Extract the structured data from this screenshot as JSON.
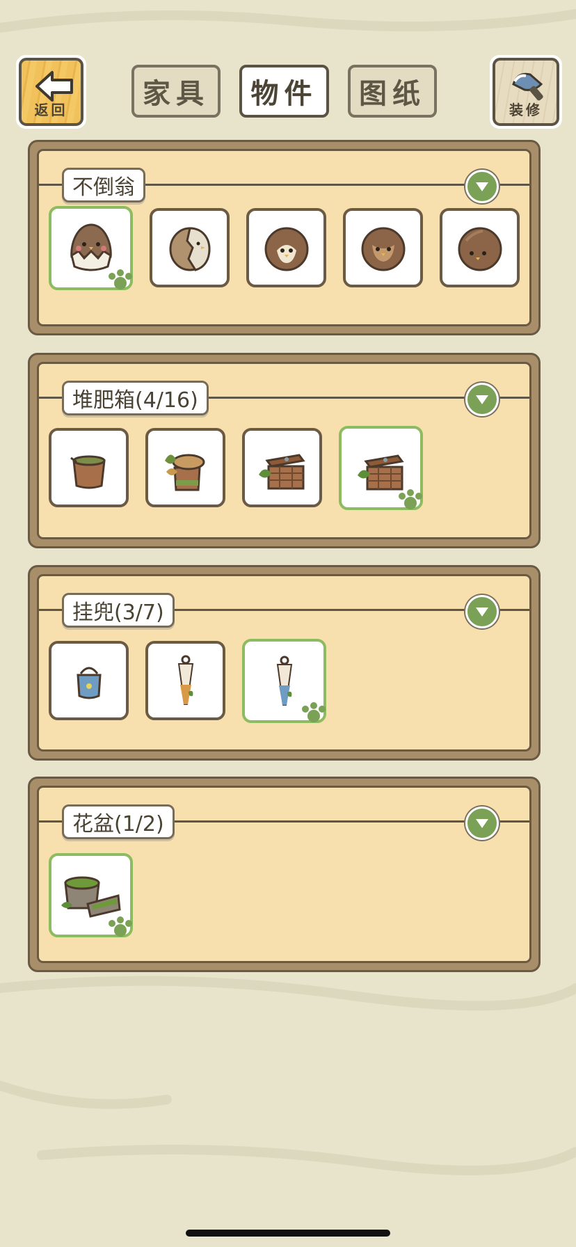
{
  "header": {
    "back_label": "返回",
    "back_icon": "arrow-left-icon",
    "tabs": [
      {
        "label": "家具",
        "active": false
      },
      {
        "label": "物件",
        "active": true
      },
      {
        "label": "图纸",
        "active": false
      }
    ],
    "decorate_label": "装修",
    "decorate_icon": "brush-icon"
  },
  "sections": [
    {
      "title": "不倒翁",
      "items": [
        "egg-cracked-red-cheeks",
        "egg-cracked-chick",
        "round-penguin-face",
        "round-owl-face",
        "round-plain-face"
      ],
      "selected_index": 0
    },
    {
      "title": "堆肥箱(4/16)",
      "items": [
        "compost-bucket",
        "compost-stump-leaves",
        "compost-crate",
        "compost-crate-lid"
      ],
      "selected_index": 3
    },
    {
      "title": "挂兜(3/7)",
      "items": [
        "blue-pail",
        "hanging-net-orange",
        "hanging-net-blue"
      ],
      "selected_index": 2
    },
    {
      "title": "花盆(1/2)",
      "items": [
        "mossy-flower-pot"
      ],
      "selected_index": 0
    }
  ],
  "colors": {
    "background": "#e8e4cc",
    "panel_fill": "#f7dfae",
    "panel_frame": "#a88e69",
    "selected_border": "#8dbb5f",
    "toggle_green": "#7aa155"
  }
}
